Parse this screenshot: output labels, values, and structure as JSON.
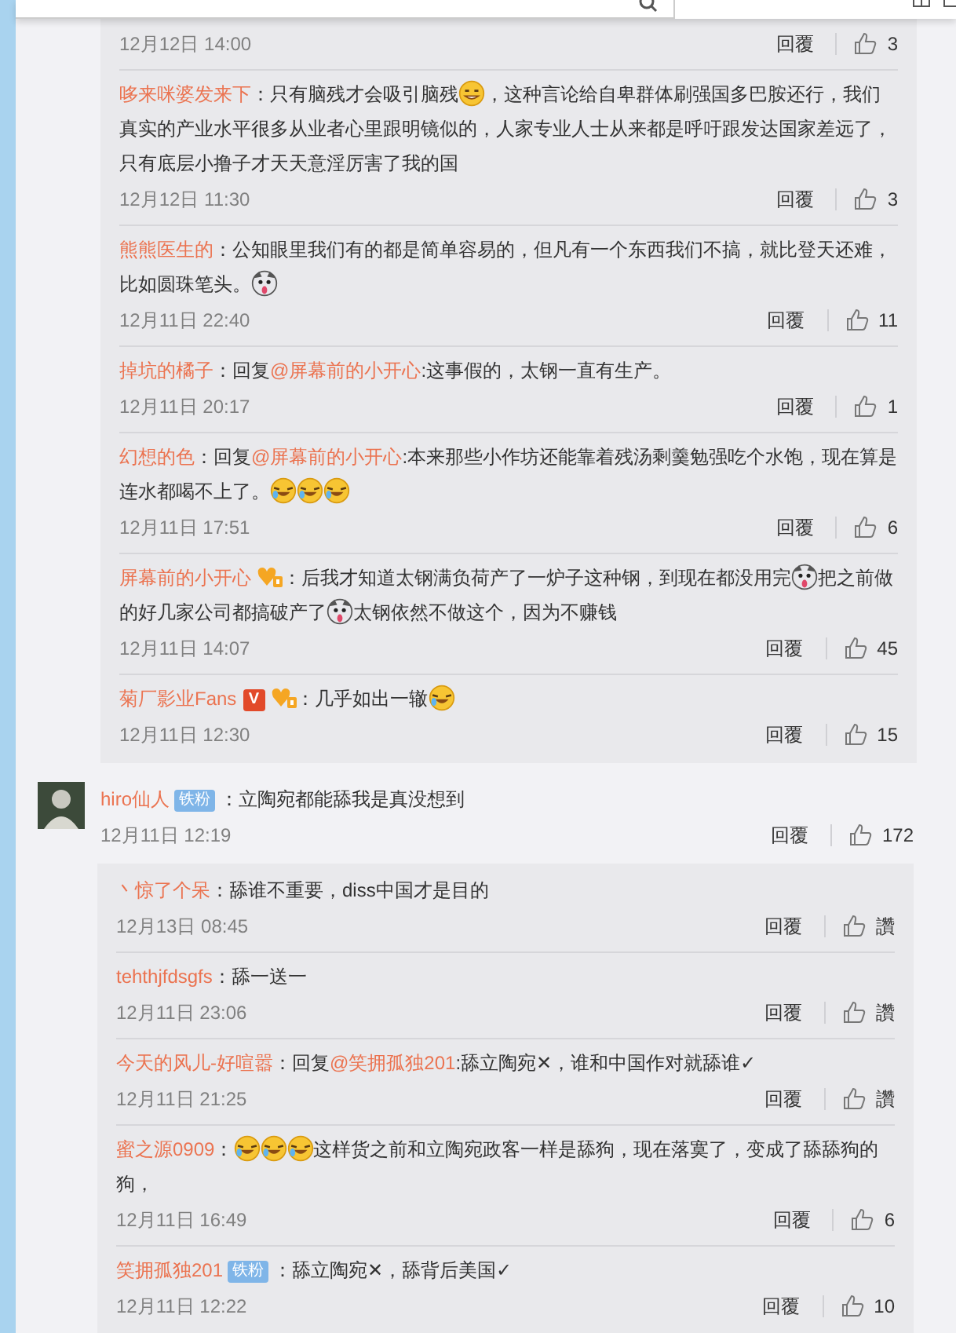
{
  "reply_group_1": {
    "replies": [
      {
        "time": "12月12日 14:00",
        "reply": "回覆",
        "likes": "3"
      },
      {
        "username": "哆来咪婆发来下",
        "body": [
          {
            "kind": "text",
            "text": "：只有脑残才会吸引脑残"
          },
          {
            "kind": "smirk"
          },
          {
            "kind": "text",
            "text": "，这种言论给自卑群体刷强国多巴胺还行，我们真实的产业水平很多从业者心里跟明镜似的，人家专业人士从来都是呼吁跟发达国家差远了，只有底层小撸子才天天意淫厉害了我的国"
          }
        ],
        "time": "12月12日 11:30",
        "reply": "回覆",
        "likes": "3"
      },
      {
        "username": "熊熊医生的",
        "body": [
          {
            "kind": "text",
            "text": "：公知眼里我们有的都是简单容易的，但凡有一个东西我们不搞，就比登天还难，比如圆珠笔头。"
          },
          {
            "kind": "husky"
          }
        ],
        "time": "12月11日 22:40",
        "reply": "回覆",
        "likes": "11"
      },
      {
        "username": "掉坑的橘子",
        "body": [
          {
            "kind": "text",
            "text": "：回复"
          },
          {
            "kind": "mention",
            "text": "@屏幕前的小开心"
          },
          {
            "kind": "text",
            "text": ":这事假的，太钢一直有生产。"
          }
        ],
        "time": "12月11日 20:17",
        "reply": "回覆",
        "likes": "1"
      },
      {
        "username": "幻想的色",
        "body": [
          {
            "kind": "text",
            "text": "：回复"
          },
          {
            "kind": "mention",
            "text": "@屏幕前的小开心"
          },
          {
            "kind": "text",
            "text": ":本来那些小作坊还能靠着残汤剩羹勉强吃个水饱，现在算是连水都喝不上了。"
          },
          {
            "kind": "laugh"
          },
          {
            "kind": "laugh"
          },
          {
            "kind": "laugh"
          }
        ],
        "time": "12月11日 17:51",
        "reply": "回覆",
        "likes": "6"
      },
      {
        "username": "屏幕前的小开心",
        "badges": [
          {
            "kind": "fan"
          }
        ],
        "body": [
          {
            "kind": "text",
            "text": "：后我才知道太钢满负荷产了一炉子这种钢，到现在都没用完"
          },
          {
            "kind": "husky"
          },
          {
            "kind": "text",
            "text": "把之前做的好几家公司都搞破产了"
          },
          {
            "kind": "husky"
          },
          {
            "kind": "text",
            "text": "太钢依然不做这个，因为不赚钱"
          }
        ],
        "time": "12月11日 14:07",
        "reply": "回覆",
        "likes": "45"
      },
      {
        "username": "菊厂影业Fans",
        "badges": [
          {
            "kind": "vip",
            "text": "V"
          },
          {
            "kind": "fan"
          }
        ],
        "body": [
          {
            "kind": "text",
            "text": "：几乎如出一辙"
          },
          {
            "kind": "laugh"
          }
        ],
        "time": "12月11日 12:30",
        "reply": "回覆",
        "likes": "15"
      }
    ]
  },
  "comment": {
    "username": "hiro仙人",
    "badges": [
      {
        "kind": "iron",
        "text": "铁粉"
      }
    ],
    "body": [
      {
        "kind": "text",
        "text": "：立陶宛都能舔我是真没想到"
      }
    ],
    "time": "12月11日 12:19",
    "reply": "回覆",
    "likes": "172"
  },
  "reply_group_2": {
    "replies": [
      {
        "username": "丶惊了个呆",
        "body": [
          {
            "kind": "text",
            "text": "：舔谁不重要，diss中国才是目的"
          }
        ],
        "time": "12月13日 08:45",
        "reply": "回覆",
        "likes": "讚"
      },
      {
        "username": "tehthjfdsgfs",
        "body": [
          {
            "kind": "text",
            "text": "：舔一送一"
          }
        ],
        "time": "12月11日 23:06",
        "reply": "回覆",
        "likes": "讚"
      },
      {
        "username": "今天的风儿-好喧嚣",
        "body": [
          {
            "kind": "text",
            "text": "：回复"
          },
          {
            "kind": "mention",
            "text": "@笑拥孤独201"
          },
          {
            "kind": "text",
            "text": ":舔立陶宛✕，谁和中国作对就舔谁✓"
          }
        ],
        "time": "12月11日 21:25",
        "reply": "回覆",
        "likes": "讚"
      },
      {
        "username": "蜜之源0909",
        "body": [
          {
            "kind": "text",
            "text": "："
          },
          {
            "kind": "laugh"
          },
          {
            "kind": "laugh"
          },
          {
            "kind": "laugh"
          },
          {
            "kind": "text",
            "text": "这样货之前和立陶宛政客一样是舔狗，现在落寞了，变成了舔舔狗的狗，"
          }
        ],
        "time": "12月11日 16:49",
        "reply": "回覆",
        "likes": "6"
      },
      {
        "username": "笑拥孤独201",
        "badges": [
          {
            "kind": "iron",
            "text": "铁粉"
          }
        ],
        "body": [
          {
            "kind": "text",
            "text": "：舔立陶宛✕，舔背后美国✓"
          }
        ],
        "time": "12月11日 12:22",
        "reply": "回覆",
        "likes": "10"
      }
    ]
  }
}
